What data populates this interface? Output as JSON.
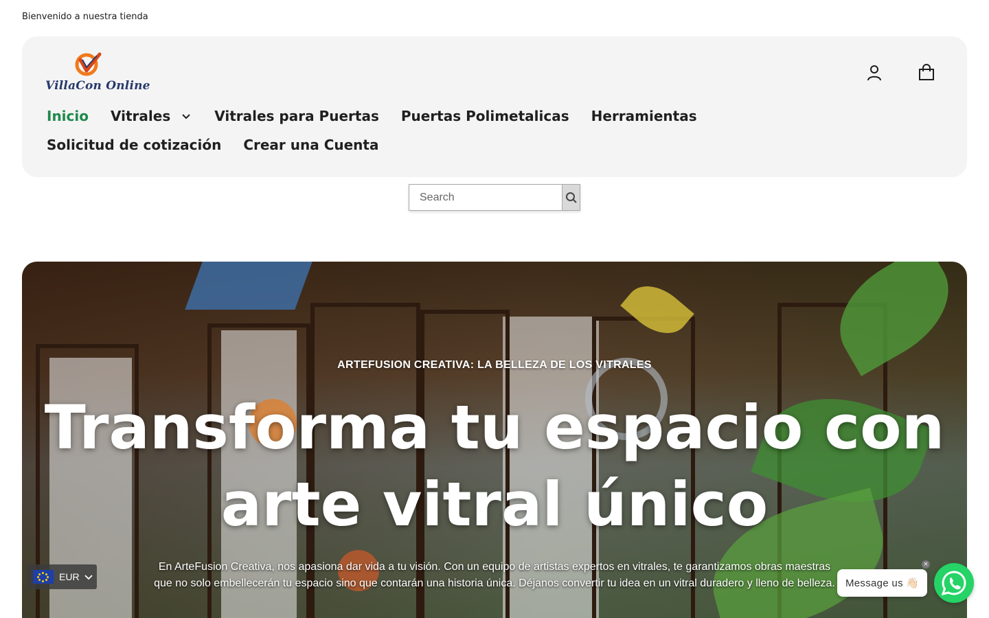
{
  "announcement": {
    "text": "Bienvenido a nuestra tienda"
  },
  "brand": {
    "logo_text": "VillaCon Online"
  },
  "header": {
    "account_icon": "user-icon",
    "cart_icon": "shopping-bag-icon"
  },
  "nav": {
    "items": [
      {
        "label": "Inicio",
        "active": true
      },
      {
        "label": "Vitrales",
        "has_dropdown": true
      },
      {
        "label": "Vitrales para Puertas"
      },
      {
        "label": "Puertas Polimetalicas"
      },
      {
        "label": "Herramientas"
      },
      {
        "label": "Solicitud de cotización"
      },
      {
        "label": "Crear una Cuenta"
      }
    ]
  },
  "search": {
    "placeholder": "Search",
    "value": "",
    "button_icon": "search-icon"
  },
  "hero": {
    "eyebrow": "ARTEFUSION CREATIVA: LA BELLEZA DE LOS VITRALES",
    "headline_line1": "Transforma tu espacio con",
    "headline_line2": "arte vitral único",
    "subcopy": "En ArteFusion Creativa, nos apasiona dar vida a tu visión. Con un equipo de artistas expertos en vitrales, te garantizamos obras maestras que no solo embellecerán tu espacio sino que contarán una historia única. Déjanos convertir tu idea en un vitral duradero y lleno de belleza."
  },
  "currency": {
    "code": "EUR",
    "flag_icon": "eu-flag-icon"
  },
  "chat": {
    "message_label": "Message us 👋🏻",
    "close": "×",
    "whatsapp_icon": "whatsapp-icon"
  },
  "colors": {
    "active_nav": "#1e8a4c",
    "header_bg": "#f4f4f4",
    "whatsapp": "#25d366"
  }
}
